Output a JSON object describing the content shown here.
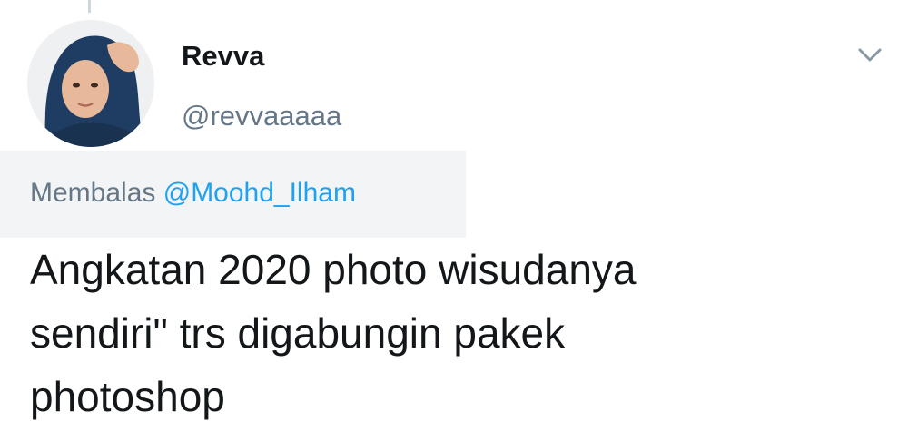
{
  "tweet": {
    "author": {
      "display_name": "Revva",
      "handle": "@revvaaaaa",
      "avatar_icon": "profile-photo"
    },
    "menu_icon": "chevron-down-icon",
    "reply": {
      "prefix": "Membalas",
      "mention": "@Moohd_Ilham"
    },
    "text": "Angkatan 2020 photo wisudanya\nsendiri\" trs digabungin pakek\nphotoshop"
  },
  "colors": {
    "text_primary": "#14171a",
    "text_secondary": "#657786",
    "link": "#1da1f2",
    "reply_background": "#f2f4f5",
    "thread_line": "#ccd6dd"
  }
}
